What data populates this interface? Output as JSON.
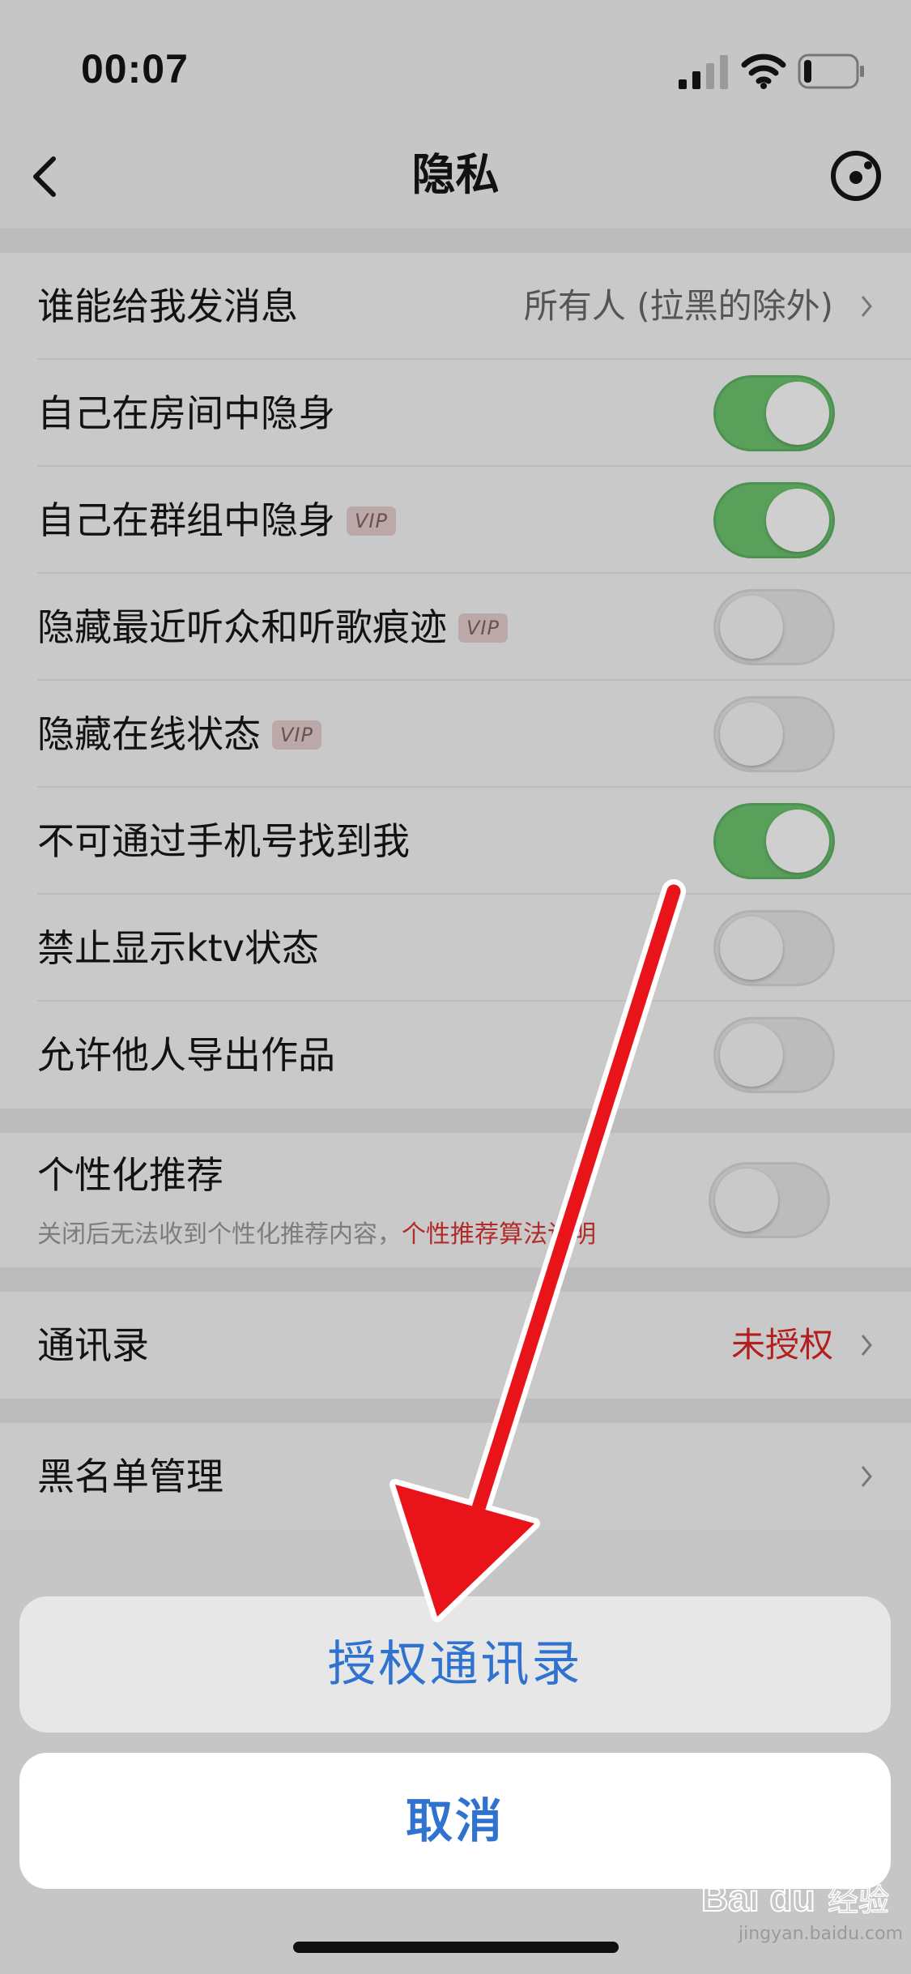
{
  "status_bar": {
    "time": "00:07",
    "battery_level": 0.15,
    "signal_bars": 2
  },
  "nav": {
    "title": "隐私"
  },
  "settings": {
    "who_can_message": {
      "label": "谁能给我发消息",
      "value": "所有人 (拉黑的除外)"
    },
    "toggles": [
      {
        "label": "自己在房间中隐身",
        "vip": "",
        "on": true
      },
      {
        "label": "自己在群组中隐身",
        "vip": "VIP",
        "on": true
      },
      {
        "label": "隐藏最近听众和听歌痕迹",
        "vip": "VIP",
        "on": false
      },
      {
        "label": "隐藏在线状态",
        "vip": "VIP",
        "on": false
      },
      {
        "label": "不可通过手机号找到我",
        "vip": "",
        "on": true
      },
      {
        "label": "禁止显示ktv状态",
        "vip": "",
        "on": false
      },
      {
        "label": "允许他人导出作品",
        "vip": "",
        "on": false
      }
    ],
    "recommendation": {
      "label": "个性化推荐",
      "subtitle": "关闭后无法收到个性化推荐内容，",
      "link": "个性推荐算法说明",
      "on": false
    },
    "contacts": {
      "label": "通讯录",
      "value": "未授权"
    },
    "blacklist": {
      "label": "黑名单管理"
    }
  },
  "action_sheet": {
    "authorize": "授权通讯录",
    "cancel": "取消"
  },
  "watermark": {
    "brand": "Bai du 经验",
    "url": "jingyan.baidu.com"
  },
  "colors": {
    "accent": "#2f72d0",
    "toggle_on": "#59a05b",
    "warning": "#b41e1e",
    "arrow": "#e8141a"
  }
}
